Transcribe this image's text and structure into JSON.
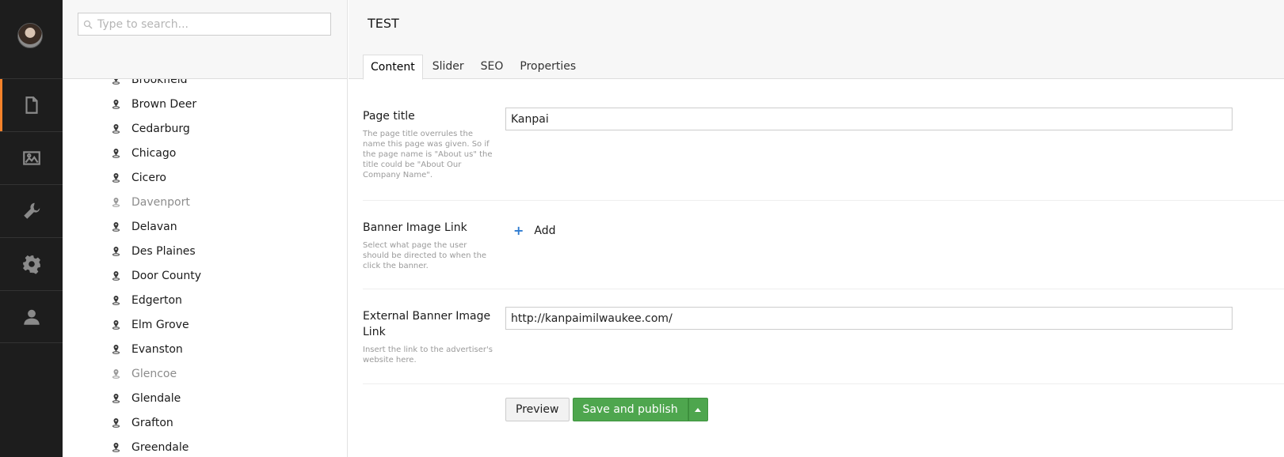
{
  "sidebar": {
    "nav": [
      {
        "name": "content",
        "icon": "document-icon",
        "active": true
      },
      {
        "name": "media",
        "icon": "image-icon",
        "active": false
      },
      {
        "name": "developer",
        "icon": "wrench-icon",
        "active": false
      },
      {
        "name": "settings",
        "icon": "gear-icon",
        "active": false
      },
      {
        "name": "users",
        "icon": "user-icon",
        "active": false
      }
    ],
    "accent_color": "#f5822a"
  },
  "tree": {
    "search_placeholder": "Type to search...",
    "items": [
      {
        "label": "Brookfield",
        "muted": false
      },
      {
        "label": "Brown Deer",
        "muted": false
      },
      {
        "label": "Cedarburg",
        "muted": false
      },
      {
        "label": "Chicago",
        "muted": false
      },
      {
        "label": "Cicero",
        "muted": false
      },
      {
        "label": "Davenport",
        "muted": true
      },
      {
        "label": "Delavan",
        "muted": false
      },
      {
        "label": "Des Plaines",
        "muted": false
      },
      {
        "label": "Door County",
        "muted": false
      },
      {
        "label": "Edgerton",
        "muted": false
      },
      {
        "label": "Elm Grove",
        "muted": false
      },
      {
        "label": "Evanston",
        "muted": false
      },
      {
        "label": "Glencoe",
        "muted": true
      },
      {
        "label": "Glendale",
        "muted": false
      },
      {
        "label": "Grafton",
        "muted": false
      },
      {
        "label": "Greendale",
        "muted": false
      }
    ]
  },
  "editor": {
    "page_name": "TEST",
    "tabs": [
      {
        "label": "Content",
        "active": true
      },
      {
        "label": "Slider",
        "active": false
      },
      {
        "label": "SEO",
        "active": false
      },
      {
        "label": "Properties",
        "active": false
      }
    ],
    "properties": {
      "page_title": {
        "label": "Page title",
        "description": "The page title overrules the name this page was given. So if the page name is \"About us\" the title could be \"About Our Company Name\".",
        "value": "Kanpai"
      },
      "banner_link": {
        "label": "Banner Image Link",
        "description": "Select what page the user should be directed to when the click the banner.",
        "add_label": "Add"
      },
      "external_banner_link": {
        "label": "External Banner Image Link",
        "description": "Insert the link to the advertiser's website here.",
        "value": "http://kanpaimilwaukee.com/"
      }
    },
    "actions": {
      "preview_label": "Preview",
      "save_label": "Save and publish"
    },
    "save_color": "#4ea64e"
  }
}
